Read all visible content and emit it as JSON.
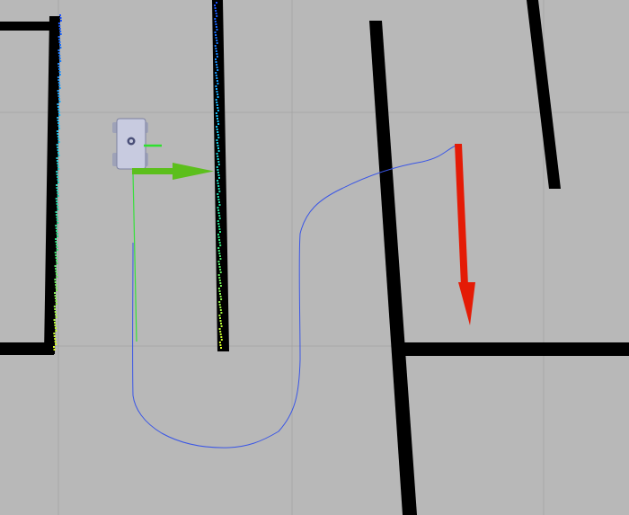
{
  "viewer": {
    "type": "3d-render-view",
    "background_color": "#b8b8b8",
    "grid_color": "#a7a7a7",
    "wall_color": "#000000"
  },
  "robot": {
    "icon": "robot-vehicle-icon",
    "body_color": "#c8cbe0",
    "axis_color": "#2ee02e"
  },
  "pose_arrows": [
    {
      "name": "current-pose-arrow",
      "color": "#5cbf1c",
      "direction": "right"
    },
    {
      "name": "goal-pose-arrow",
      "color": "#e41b06",
      "direction": "down"
    }
  ],
  "paths": {
    "global_plan_color": "#3a56e6",
    "local_plan_color": "#35e03a"
  },
  "laser_scan": {
    "colormap": [
      "#1a50ff",
      "#19c8ff",
      "#22e080",
      "#e0ff20"
    ]
  }
}
